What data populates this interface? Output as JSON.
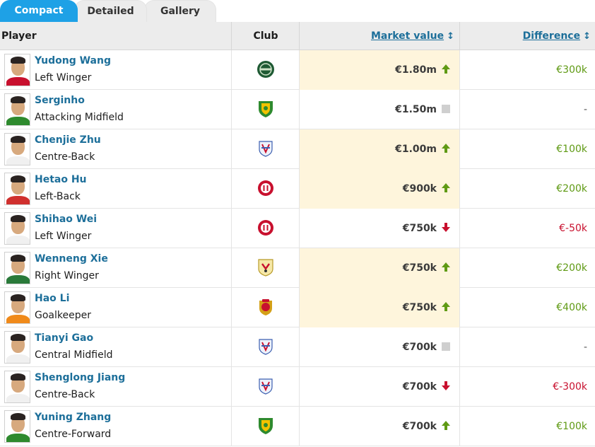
{
  "tabs": [
    {
      "label": "Compact",
      "active": true
    },
    {
      "label": "Detailed",
      "active": false
    },
    {
      "label": "Gallery",
      "active": false
    }
  ],
  "table": {
    "headers": {
      "player": "Player",
      "club": "Club",
      "market_value": "Market value",
      "difference": "Difference"
    },
    "sort_icon": "↕",
    "colors": {
      "up": "#5f9a14",
      "down": "#c8102e",
      "neutral": "#555555",
      "highlight": "#fef5dc"
    },
    "rows": [
      {
        "name": "Yudong Wang",
        "position": "Left Winger",
        "club_icon": "club-crest-green-round-icon",
        "market_value": "€1.80m",
        "trend": "up",
        "difference": "€300k",
        "highlighted": true
      },
      {
        "name": "Serginho",
        "position": "Attacking Midfield",
        "club_icon": "club-crest-green-shield-icon",
        "market_value": "€1.50m",
        "trend": "none",
        "difference": "-",
        "highlighted": false
      },
      {
        "name": "Chenjie Zhu",
        "position": "Centre-Back",
        "club_icon": "club-crest-blue-shield-icon",
        "market_value": "€1.00m",
        "trend": "up",
        "difference": "€100k",
        "highlighted": true
      },
      {
        "name": "Hetao Hu",
        "position": "Left-Back",
        "club_icon": "club-crest-red-round-icon",
        "market_value": "€900k",
        "trend": "up",
        "difference": "€200k",
        "highlighted": true
      },
      {
        "name": "Shihao Wei",
        "position": "Left Winger",
        "club_icon": "club-crest-red-round-icon",
        "market_value": "€750k",
        "trend": "down",
        "difference": "€-50k",
        "highlighted": false
      },
      {
        "name": "Wenneng Xie",
        "position": "Right Winger",
        "club_icon": "club-crest-yellow-shield-icon",
        "market_value": "€750k",
        "trend": "up",
        "difference": "€200k",
        "highlighted": true
      },
      {
        "name": "Hao Li",
        "position": "Goalkeeper",
        "club_icon": "club-crest-red-gold-icon",
        "market_value": "€750k",
        "trend": "up",
        "difference": "€400k",
        "highlighted": true
      },
      {
        "name": "Tianyi Gao",
        "position": "Central Midfield",
        "club_icon": "club-crest-blue-shield-icon",
        "market_value": "€700k",
        "trend": "none",
        "difference": "-",
        "highlighted": false
      },
      {
        "name": "Shenglong Jiang",
        "position": "Centre-Back",
        "club_icon": "club-crest-blue-shield-icon",
        "market_value": "€700k",
        "trend": "down",
        "difference": "€-300k",
        "highlighted": false
      },
      {
        "name": "Yuning Zhang",
        "position": "Centre-Forward",
        "club_icon": "club-crest-green-shield-icon",
        "market_value": "€700k",
        "trend": "up",
        "difference": "€100k",
        "highlighted": false
      }
    ]
  }
}
